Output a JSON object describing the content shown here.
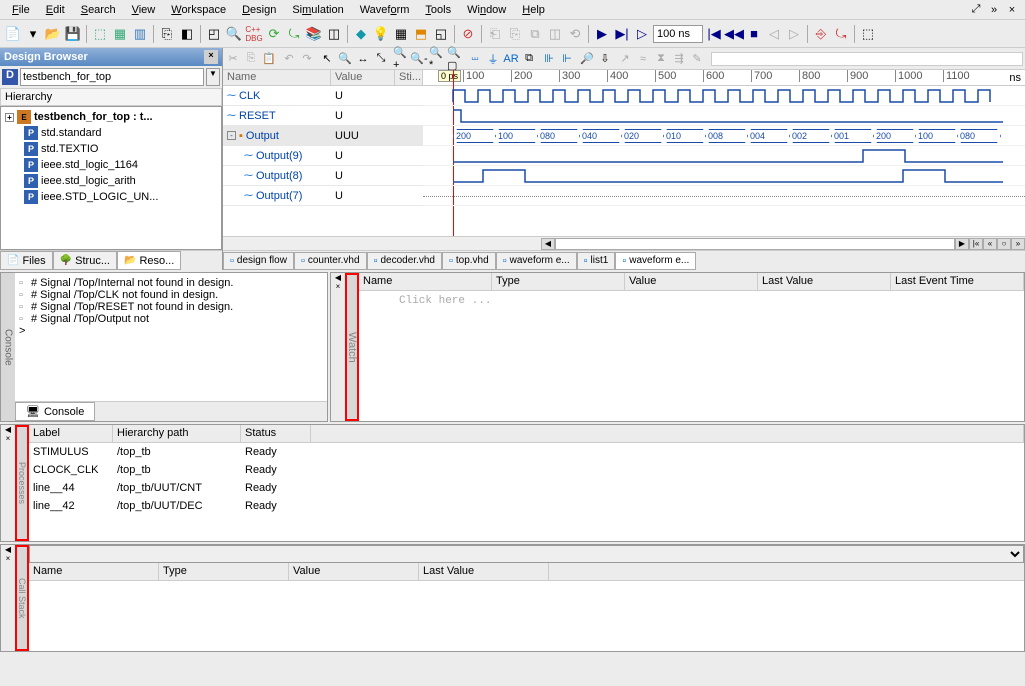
{
  "menu": {
    "file": "File",
    "edit": "Edit",
    "search": "Search",
    "view": "View",
    "workspace": "Workspace",
    "design": "Design",
    "simulation": "Simulation",
    "waveform": "Waveform",
    "tools": "Tools",
    "window": "Window",
    "help": "Help"
  },
  "time_input": "100 ns",
  "design_browser": {
    "title": "Design Browser",
    "combo": "testbench_for_top",
    "hierarchy_label": "Hierarchy",
    "tree": [
      {
        "label": "testbench_for_top : t...",
        "bold": true,
        "icon": "E",
        "expand": "+"
      },
      {
        "label": "std.standard",
        "icon": "P",
        "indent": 1
      },
      {
        "label": "std.TEXTIO",
        "icon": "P",
        "indent": 1
      },
      {
        "label": "ieee.std_logic_1164",
        "icon": "P",
        "indent": 1
      },
      {
        "label": "ieee.std_logic_arith",
        "icon": "P",
        "indent": 1
      },
      {
        "label": "ieee.STD_LOGIC_UN...",
        "icon": "P",
        "indent": 1
      }
    ],
    "tabs": {
      "files": "Files",
      "struc": "Struc...",
      "reso": "Reso..."
    }
  },
  "signals": {
    "headers": {
      "name": "Name",
      "value": "Value",
      "sti": "Sti..."
    },
    "rows": [
      {
        "name": "CLK",
        "value": "U"
      },
      {
        "name": "RESET",
        "value": "U"
      },
      {
        "name": "Output",
        "value": "UUU",
        "bus": true,
        "sel": true
      },
      {
        "name": "Output(9)",
        "value": "U",
        "indent": true
      },
      {
        "name": "Output(8)",
        "value": "U",
        "indent": true
      },
      {
        "name": "Output(7)",
        "value": "U",
        "indent": true
      }
    ],
    "cursor": "0 ps",
    "unit": "ns",
    "ticks": [
      "100",
      "200",
      "300",
      "400",
      "500",
      "600",
      "700",
      "800",
      "900",
      "1000",
      "1100"
    ],
    "bus_values": [
      "200",
      "100",
      "080",
      "040",
      "020",
      "010",
      "008",
      "004",
      "002",
      "001",
      "200",
      "100",
      "080"
    ]
  },
  "file_tabs": [
    "design flow",
    "counter.vhd",
    "decoder.vhd",
    "top.vhd",
    "waveform e...",
    "list1",
    "waveform e..."
  ],
  "console": {
    "label": "Console",
    "title": "Console",
    "lines": [
      "# Signal /Top/Internal not found in design.",
      "# Signal /Top/CLK not found in design.",
      "# Signal /Top/RESET not found in design.",
      "# Signal /Top/Output not"
    ],
    "prompt": ">"
  },
  "watch": {
    "label": "Watch",
    "headers": [
      "Name",
      "Type",
      "Value",
      "Last Value",
      "Last Event Time"
    ],
    "placeholder": "Click here ..."
  },
  "processes": {
    "label": "Processes",
    "headers": {
      "label": "Label",
      "path": "Hierarchy path",
      "status": "Status"
    },
    "rows": [
      {
        "label": "STIMULUS",
        "path": "/top_tb",
        "status": "Ready"
      },
      {
        "label": "CLOCK_CLK",
        "path": "/top_tb",
        "status": "Ready"
      },
      {
        "label": "line__44",
        "path": "/top_tb/UUT/CNT",
        "status": "Ready"
      },
      {
        "label": "line__42",
        "path": "/top_tb/UUT/DEC",
        "status": "Ready"
      }
    ]
  },
  "callstack": {
    "label": "Call Stack",
    "headers": [
      "Name",
      "Type",
      "Value",
      "Last Value"
    ]
  }
}
